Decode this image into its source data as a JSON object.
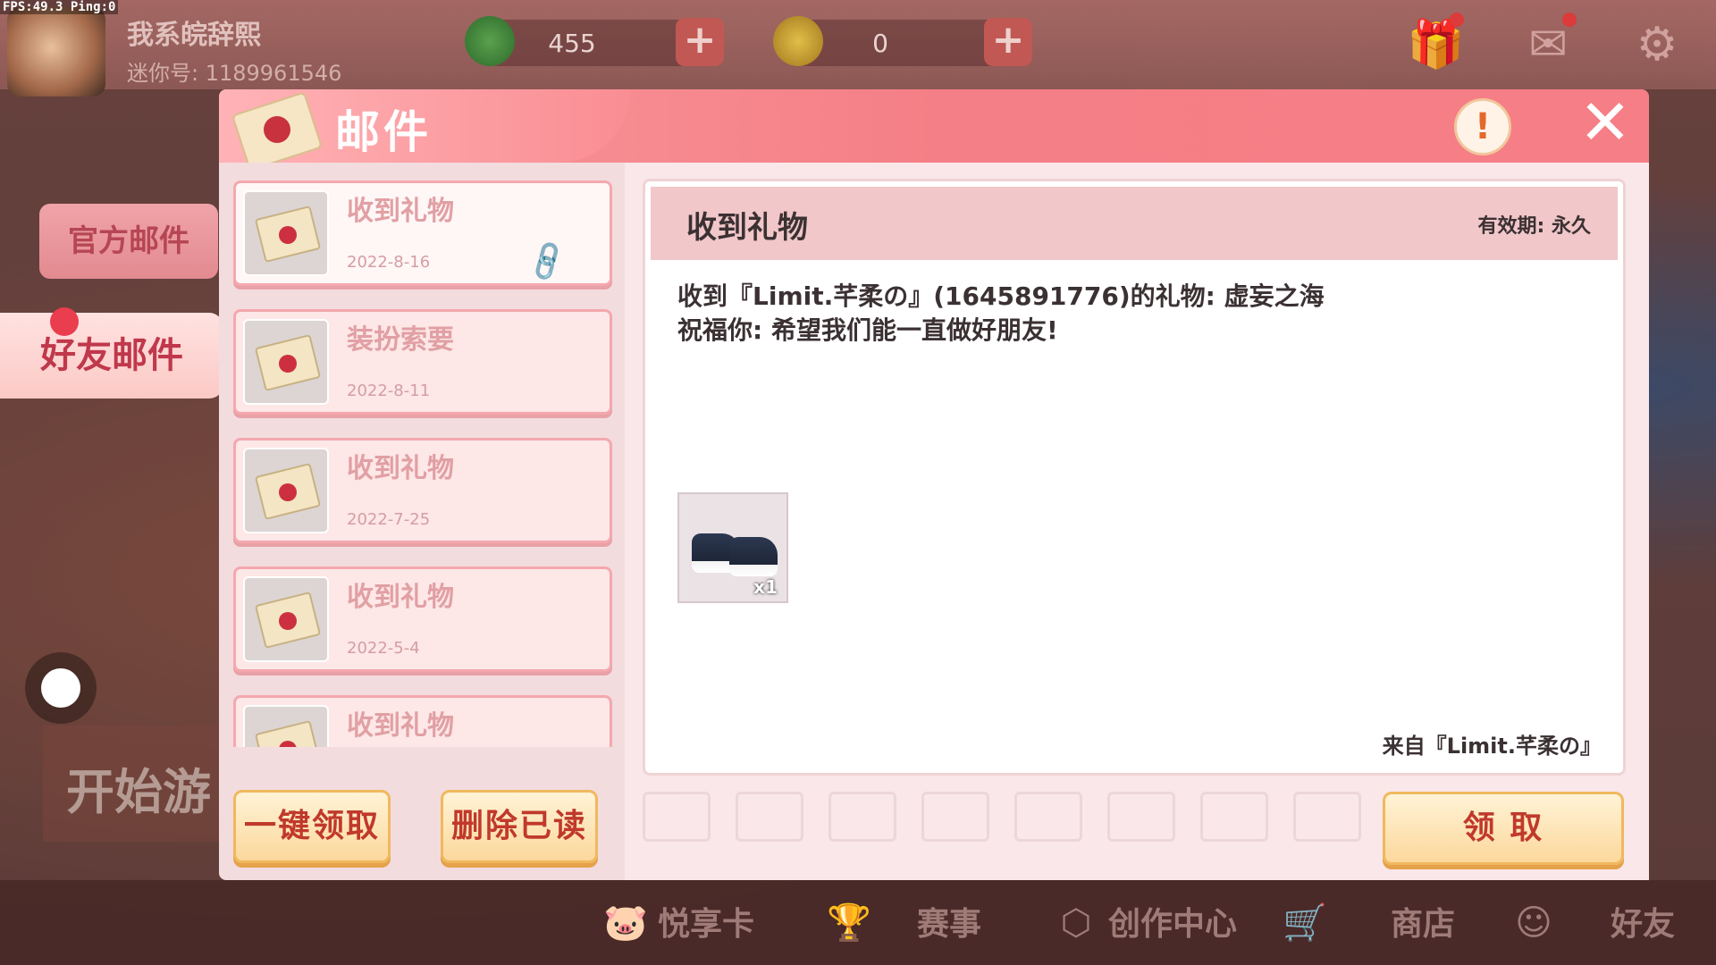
{
  "hud": {
    "fps": "FPS:49.3  Ping:0",
    "player_name": "我系皖辞熙",
    "player_id": "迷你号: 1189961546",
    "currency_green": "455",
    "currency_gold": "0",
    "plus": "+"
  },
  "side_tabs": {
    "official": "官方邮件",
    "friend": "好友邮件"
  },
  "background": {
    "start_game": "开始游"
  },
  "dialog": {
    "title": "邮件",
    "info_icon": "!",
    "close_icon": "✕",
    "mail_list": [
      {
        "title": "收到礼物",
        "date": "2022-8-16",
        "has_attachment": true,
        "active": true
      },
      {
        "title": "装扮索要",
        "date": "2022-8-11",
        "has_attachment": false,
        "active": false
      },
      {
        "title": "收到礼物",
        "date": "2022-7-25",
        "has_attachment": false,
        "active": false
      },
      {
        "title": "收到礼物",
        "date": "2022-5-4",
        "has_attachment": false,
        "active": false
      },
      {
        "title": "收到礼物",
        "date": "",
        "has_attachment": false,
        "active": false
      }
    ],
    "claim_all": "一键领取",
    "delete_read": "删除已读",
    "detail": {
      "title": "收到礼物",
      "validity": "有效期: 永久",
      "line1": "收到『Limit.芊柔の』(1645891776)的礼物: 虚妄之海",
      "line2": "祝福你: 希望我们能一直做好朋友!",
      "reward_qty": "x1",
      "sender": "来自『Limit.芊柔の』"
    },
    "claim": "领 取"
  },
  "bottom_nav": [
    {
      "label": "悦享卡",
      "icon": "pig-card-icon"
    },
    {
      "label": "赛事",
      "icon": "trophy-icon"
    },
    {
      "label": "创作中心",
      "icon": "cube-icon"
    },
    {
      "label": "商店",
      "icon": "shop-cart-icon"
    },
    {
      "label": "好友",
      "icon": "friend-icon"
    }
  ],
  "colors": {
    "header_pink": "#f67e86",
    "title_text": "#3b3133",
    "button_text": "#c0392b"
  }
}
